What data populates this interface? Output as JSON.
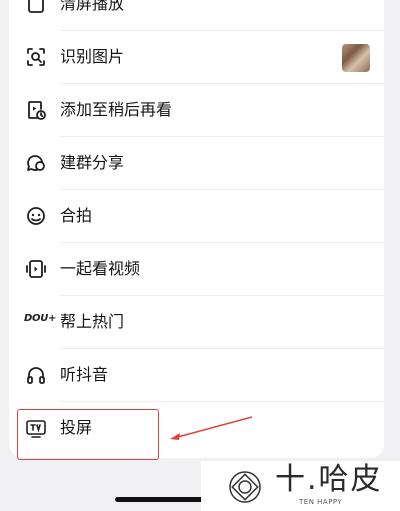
{
  "menu": {
    "items": [
      {
        "label": "清屏播放",
        "icon": "clear-screen-icon"
      },
      {
        "label": "识别图片",
        "icon": "scan-image-icon"
      },
      {
        "label": "添加至稍后再看",
        "icon": "watch-later-icon"
      },
      {
        "label": "建群分享",
        "icon": "group-share-icon"
      },
      {
        "label": "合拍",
        "icon": "duet-icon"
      },
      {
        "label": "一起看视频",
        "icon": "watch-together-icon"
      },
      {
        "label": "帮上热门",
        "icon": "dou-plus-icon",
        "icon_text": "DOU+"
      },
      {
        "label": "听抖音",
        "icon": "headphones-icon"
      },
      {
        "label": "投屏",
        "icon": "tv-cast-icon"
      }
    ]
  },
  "watermark": {
    "title": "十.哈皮",
    "subtitle": "TEN HAPPY"
  },
  "colors": {
    "highlight": "#e0433f",
    "text": "#161616"
  }
}
